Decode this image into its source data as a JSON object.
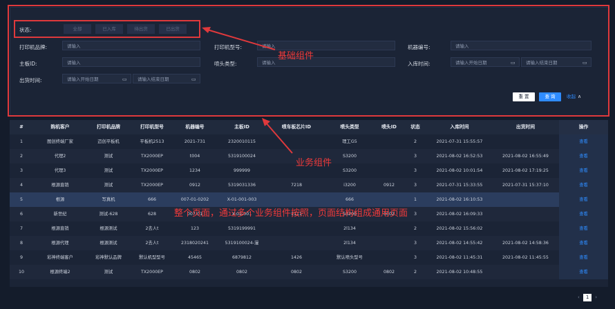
{
  "filters": {
    "status_label": "状态:",
    "status_options": [
      "全部",
      "已入库",
      "待出货",
      "已出货"
    ],
    "brand_label": "打印机品牌:",
    "model_label": "打印机型号:",
    "machine_no_label": "机器编号:",
    "board_id_label": "主板ID:",
    "nozzle_type_label": "喷头类型:",
    "in_time_label": "入库时间:",
    "out_time_label": "出货时间:",
    "input_placeholder": "请输入",
    "start_date_placeholder": "请输入开始日期",
    "end_date_placeholder": "请输入结束日期",
    "reset_label": "重 置",
    "query_label": "查 询",
    "collapse_label": "收起"
  },
  "table": {
    "headers": [
      "#",
      "购机客户",
      "打印机品牌",
      "打印机型号",
      "机器编号",
      "主板ID",
      "喷车板芯片ID",
      "喷头类型",
      "喷头ID",
      "状态",
      "入库时间",
      "出货时间",
      "操作"
    ],
    "rows": [
      [
        "1",
        "图创终端厂家",
        "迈创平板机",
        "平板机2513",
        "2021-731",
        "2320010115",
        "",
        "理工G5",
        "",
        "2",
        "2021-07-31 15:55:57",
        "",
        "查看"
      ],
      [
        "2",
        "代理2",
        "测试",
        "TX2000EP",
        "t004",
        "5319100024",
        "",
        "S3200",
        "",
        "3",
        "2021-08-02 16:52:53",
        "2021-08-02 16:55:49",
        "查看"
      ],
      [
        "3",
        "代理3",
        "测试",
        "TX2000EP",
        "1234",
        "999999",
        "",
        "S3200",
        "",
        "3",
        "2021-08-02 10:01:54",
        "2021-08-02 17:19:25",
        "查看"
      ],
      [
        "4",
        "根源直销",
        "测试",
        "TX2000EP",
        "0912",
        "5319031336",
        "7218",
        "i3200",
        "0912",
        "3",
        "2021-07-31 15:33:55",
        "2021-07-31 15:37:10",
        "查看"
      ],
      [
        "5",
        "根源",
        "写真机",
        "666",
        "007-01-0202",
        "X-01-001-003",
        "",
        "666",
        "",
        "1",
        "2021-08-02 16:10:53",
        "",
        "查看"
      ],
      [
        "6",
        "新世纪",
        "测试-628",
        "628",
        "007-01",
        "X-01-001",
        "1111",
        "S3200",
        "0002",
        "3",
        "2021-08-02 16:09:33",
        "",
        "查看"
      ],
      [
        "7",
        "根源直销",
        "根源测试",
        "2去人t",
        "123",
        "5319199991",
        "",
        "2l134",
        "",
        "2",
        "2021-08-02 15:56:02",
        "",
        "查看"
      ],
      [
        "8",
        "根源代理",
        "根源测试",
        "2去人t",
        "2318020241",
        "5319100024-漫",
        "",
        "2l134",
        "",
        "3",
        "2021-08-02 14:55:42",
        "2021-08-02 14:58:36",
        "查看"
      ],
      [
        "9",
        "彩神终端客户",
        "彩神默认品牌",
        "默认机型型号",
        "45465",
        "6879812",
        "1426",
        "默认喷头型号",
        "",
        "3",
        "2021-08-02 11:45:31",
        "2021-08-02 11:45:55",
        "查看"
      ],
      [
        "10",
        "根源终端2",
        "测试",
        "TX2000EP",
        "0802",
        "0802",
        "0802",
        "S3200",
        "0802",
        "2",
        "2021-08-02 10:48:55",
        "",
        "查看"
      ]
    ]
  },
  "pagination": {
    "prev": "‹",
    "current": "1",
    "next": "›"
  },
  "annotations": {
    "basic_component": "基础组件",
    "business_component": "业务组件",
    "page_note": "整个页面，通过多个业务组件按照，页面结构组成通用页面"
  },
  "colors": {
    "accent": "#2f8cff",
    "annotation": "#e0393c",
    "background": "#141c2b"
  }
}
